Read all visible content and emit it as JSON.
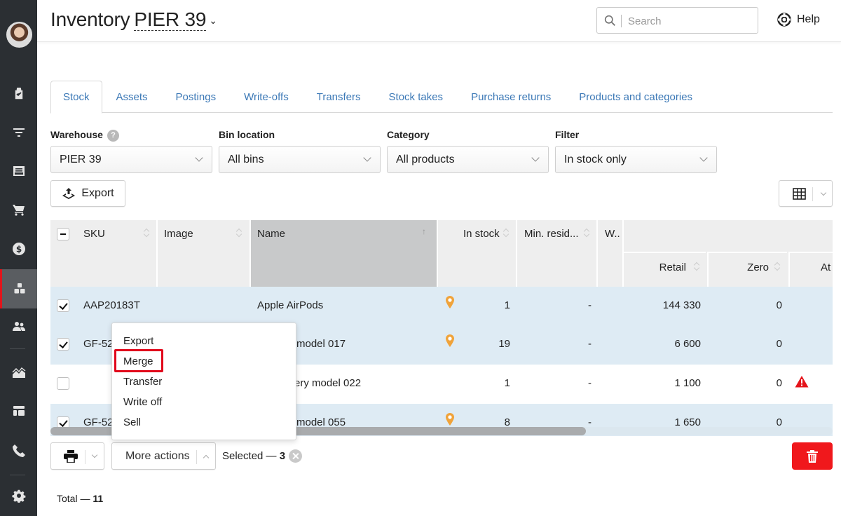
{
  "sidebar": {
    "avatar": "user-avatar",
    "items": [
      {
        "name": "tasks",
        "icon": "clipboard-check-icon"
      },
      {
        "name": "funnel",
        "icon": "funnel-icon"
      },
      {
        "name": "orders",
        "icon": "inbox-icon"
      },
      {
        "name": "sales",
        "icon": "cart-icon"
      },
      {
        "name": "finance",
        "icon": "dollar-icon"
      },
      {
        "name": "inventory",
        "icon": "boxes-icon",
        "active": true
      },
      {
        "name": "clients",
        "icon": "users-icon"
      },
      {
        "name": "reports",
        "icon": "chart-area-icon"
      },
      {
        "name": "dashboard",
        "icon": "layout-icon"
      },
      {
        "name": "calls",
        "icon": "phone-icon"
      },
      {
        "name": "settings",
        "icon": "gear-icon"
      }
    ],
    "accent_color": "#e2141b"
  },
  "header": {
    "title": "Inventory",
    "store": "PIER 39",
    "search_placeholder": "Search",
    "help_label": "Help"
  },
  "tabs": [
    {
      "label": "Stock",
      "active": true
    },
    {
      "label": "Assets"
    },
    {
      "label": "Postings"
    },
    {
      "label": "Write-offs"
    },
    {
      "label": "Transfers"
    },
    {
      "label": "Stock takes"
    },
    {
      "label": "Purchase returns"
    },
    {
      "label": "Products and categories"
    }
  ],
  "filters": {
    "warehouse": {
      "label": "Warehouse",
      "help": "?",
      "value": "PIER 39"
    },
    "bin_location": {
      "label": "Bin location",
      "value": "All bins"
    },
    "category": {
      "label": "Category",
      "value": "All products"
    },
    "filter": {
      "label": "Filter",
      "value": "In stock only"
    }
  },
  "toolbar": {
    "export_label": "Export"
  },
  "table": {
    "columns": {
      "sku": "SKU",
      "image": "Image",
      "name": "Name",
      "in_stock": "In stock",
      "min_residual": "Min. resid...",
      "w": "W..",
      "retail": "Retail",
      "zero": "Zero",
      "at": "At"
    },
    "rows": [
      {
        "checked": true,
        "sku": "AAP20183T",
        "name": "Apple AirPods",
        "pin": true,
        "in_stock": "1",
        "min_residual": "-",
        "retail": "144 330",
        "zero": "0",
        "warning": false
      },
      {
        "checked": true,
        "sku": "GF-52",
        "name": "model 017",
        "pin": true,
        "in_stock": "19",
        "min_residual": "-",
        "retail": "6 600",
        "zero": "0",
        "warning": false
      },
      {
        "checked": false,
        "sku": "",
        "name": "ery model 022",
        "pin": false,
        "in_stock": "1",
        "min_residual": "-",
        "retail": "1 100",
        "zero": "0",
        "warning": true
      },
      {
        "checked": true,
        "sku": "GF-52",
        "name": "model 055",
        "pin": true,
        "in_stock": "8",
        "min_residual": "-",
        "retail": "1 650",
        "zero": "0",
        "warning": false
      }
    ],
    "scroll_position": 0
  },
  "context_menu": {
    "items": [
      "Export",
      "Merge",
      "Transfer",
      "Write off",
      "Sell"
    ],
    "highlighted": "Merge"
  },
  "bottom_bar": {
    "more_actions_label": "More actions",
    "selected_label": "Selected —",
    "selected_count": "3",
    "total_label": "Total —",
    "total_count": "11",
    "delete_color": "#f0181c"
  }
}
